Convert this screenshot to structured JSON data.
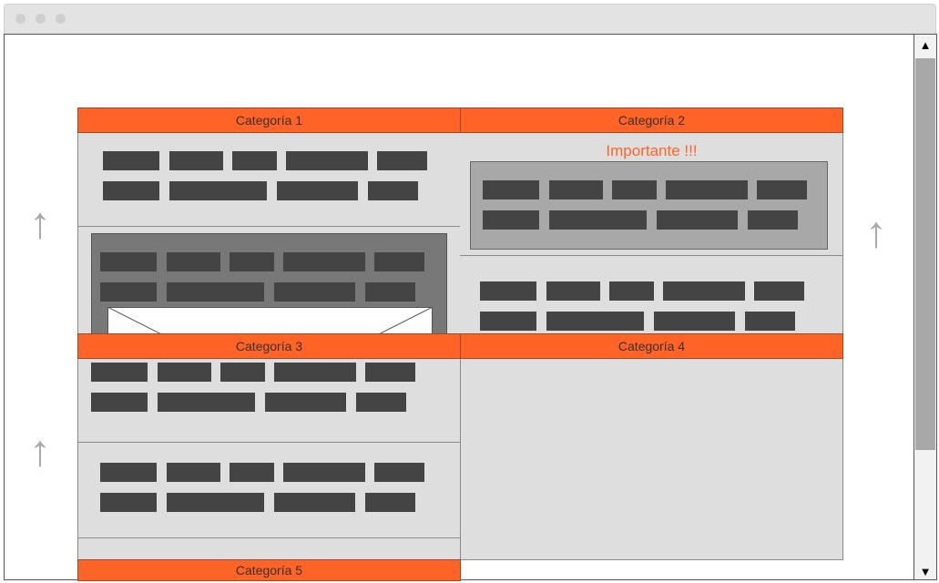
{
  "window": {
    "controls": [
      "close-dot",
      "minimize-dot",
      "maximize-dot"
    ]
  },
  "scrollbar": {
    "up_label": "▲",
    "down_label": "▼"
  },
  "side_arrows": {
    "glyph": "↑"
  },
  "categories": {
    "c1": "Categoría 1",
    "c2": "Categoría 2",
    "c3": "Categoría 3",
    "c4": "Categoría 4",
    "c5": "Categoría 5"
  },
  "important_label": "Importante !!!",
  "colors": {
    "accent": "#ff6326",
    "panel": "#dedede",
    "block": "#444444",
    "dark_box": "#787878",
    "mid_box": "#a8a8a8"
  }
}
